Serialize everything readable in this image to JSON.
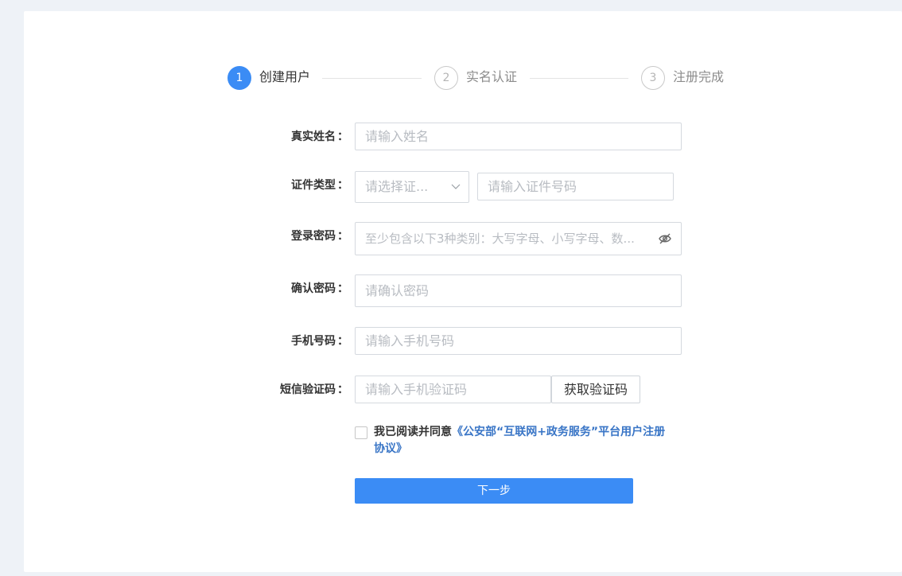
{
  "steps": [
    {
      "number": "1",
      "label": "创建用户"
    },
    {
      "number": "2",
      "label": "实名认证"
    },
    {
      "number": "3",
      "label": "注册完成"
    }
  ],
  "form": {
    "name": {
      "label": "真实姓名",
      "placeholder": "请输入姓名"
    },
    "id_type": {
      "label": "证件类型",
      "select_placeholder": "请选择证...",
      "number_placeholder": "请输入证件号码"
    },
    "password": {
      "label": "登录密码",
      "placeholder": "至少包含以下3种类别：大写字母、小写字母、数..."
    },
    "confirm_password": {
      "label": "确认密码",
      "placeholder": "请确认密码"
    },
    "phone": {
      "label": "手机号码",
      "placeholder": "请输入手机号码"
    },
    "sms_code": {
      "label": "短信验证码",
      "placeholder": "请输入手机验证码",
      "button_label": "获取验证码"
    },
    "colon": "："
  },
  "agreement": {
    "prefix": "我已阅读并同意",
    "link_text": "《公安部“互联网+政务服务”平台用户注册协议》"
  },
  "next_button": {
    "label": "下一步"
  },
  "colors": {
    "primary": "#3b8cf5",
    "link": "#3975c6"
  }
}
